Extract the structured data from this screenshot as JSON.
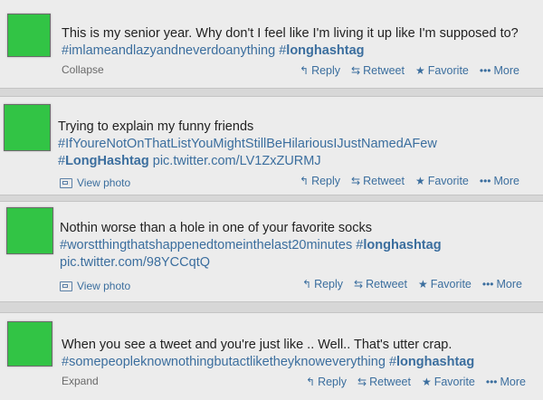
{
  "tweets": [
    {
      "line1": "This is my senior year. Why don't I feel like I'm living it up like I'm supposed to?",
      "line2_hash": "#imlameandlazyandneverdoanything",
      "line2_hash_bold_prefix": "#",
      "line2_hash_bold": "longhashtag",
      "toggle": "Collapse"
    },
    {
      "line1": "Trying to explain my funny friends",
      "line2_hash": "#IfYoureNotOnThatListYouMightStillBeHilariousIJustNamedAFew",
      "line3_hash_prefix": "#",
      "line3_hash_bold": "LongHashtag",
      "line3_link": "pic.twitter.com/LV1ZxZURMJ",
      "view_photo": "View photo"
    },
    {
      "line1": "Nothin worse than a hole in one of your favorite socks",
      "line2_hash": "#worstthingthatshappenedtomeinthelast20minutes",
      "line2_hash_bold_prefix": "#",
      "line2_hash_bold": "longhashtag",
      "line3_link": "pic.twitter.com/98YCCqtQ",
      "view_photo": "View photo"
    },
    {
      "line1": "When you see a tweet and you're just like .. Well.. That's utter crap.",
      "line2_hash": "#somepeopleknownothingbutactliketheyknoweverything",
      "line2_hash_bold_prefix": "#",
      "line2_hash_bold": "longhashtag",
      "toggle": "Expand"
    }
  ],
  "actions": {
    "reply": "Reply",
    "retweet": "Retweet",
    "favorite": "Favorite",
    "more": "More"
  },
  "icons": {
    "reply": "reply-arrow-icon",
    "retweet": "retweet-icon",
    "favorite": "star-icon",
    "more": "dots-icon",
    "photo": "photo-icon"
  },
  "colors": {
    "avatar": "#32c445",
    "link": "#3b6e9e",
    "background": "#ececec"
  }
}
